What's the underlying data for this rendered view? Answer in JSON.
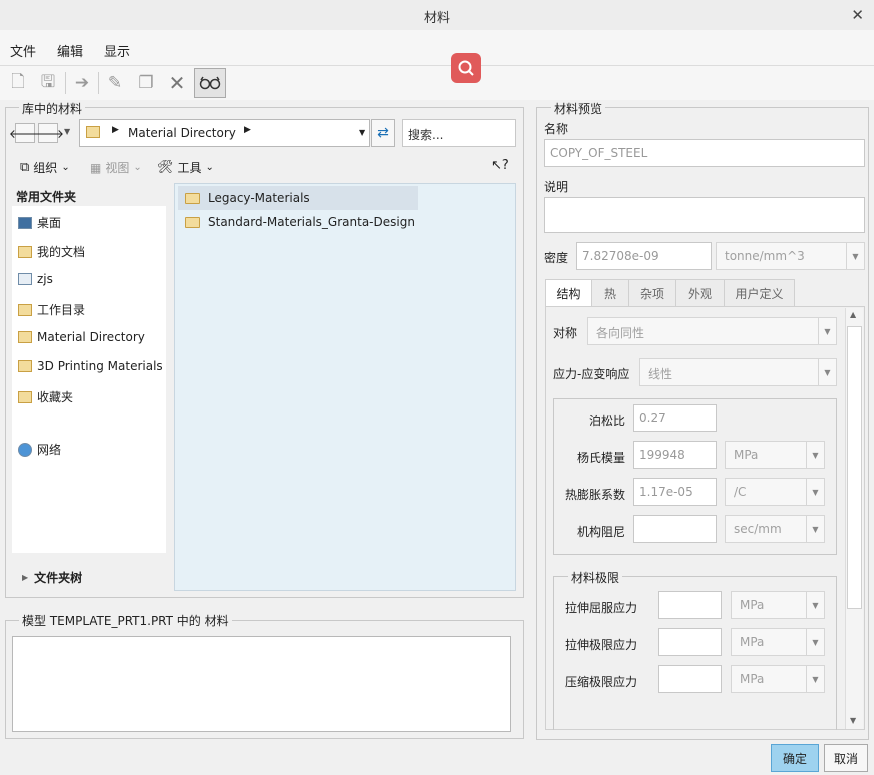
{
  "window": {
    "title": "材料"
  },
  "menu": {
    "file": "文件",
    "edit": "编辑",
    "view": "显示"
  },
  "library": {
    "group_title": "库中的材料",
    "path": "Material Directory",
    "search_placeholder": "搜索...",
    "toolbar": {
      "organize": "组织",
      "view": "视图",
      "tools": "工具"
    },
    "sidebar_title": "常用文件夹",
    "sidebar_items": [
      {
        "label": "桌面"
      },
      {
        "label": "我的文档"
      },
      {
        "label": "zjs"
      },
      {
        "label": "工作目录"
      },
      {
        "label": "Material Directory"
      },
      {
        "label": "3D Printing Materials"
      },
      {
        "label": "收藏夹"
      },
      {
        "label": "网络"
      }
    ],
    "folder_tree": "文件夹树",
    "files": [
      {
        "name": "Legacy-Materials"
      },
      {
        "name": "Standard-Materials_Granta-Design"
      }
    ]
  },
  "model": {
    "group_title": "模型 TEMPLATE_PRT1.PRT 中的 材料"
  },
  "preview": {
    "group_title": "材料预览",
    "name_label": "名称",
    "name_value": "COPY_OF_STEEL",
    "desc_label": "说明",
    "density_label": "密度",
    "density_value": "7.82708e-09",
    "density_unit": "tonne/mm^3",
    "tabs": [
      "结构",
      "热",
      "杂项",
      "外观",
      "用户定义"
    ],
    "symmetry_label": "对称",
    "symmetry_value": "各向同性",
    "stress_label": "应力-应变响应",
    "stress_value": "线性",
    "poisson_label": "泊松比",
    "poisson_value": "0.27",
    "young_label": "杨氏模量",
    "young_value": "199948",
    "young_unit": "MPa",
    "thermal_label": "热膨胀系数",
    "thermal_value": "1.17e-05",
    "thermal_unit": "/C",
    "damping_label": "机构阻尼",
    "damping_unit": "sec/mm",
    "limits_title": "材料极限",
    "tensile_yield_label": "拉伸屈服应力",
    "tensile_ult_label": "拉伸极限应力",
    "compress_label": "压缩极限应力",
    "limit_unit": "MPa"
  },
  "buttons": {
    "ok": "确定",
    "cancel": "取消"
  }
}
